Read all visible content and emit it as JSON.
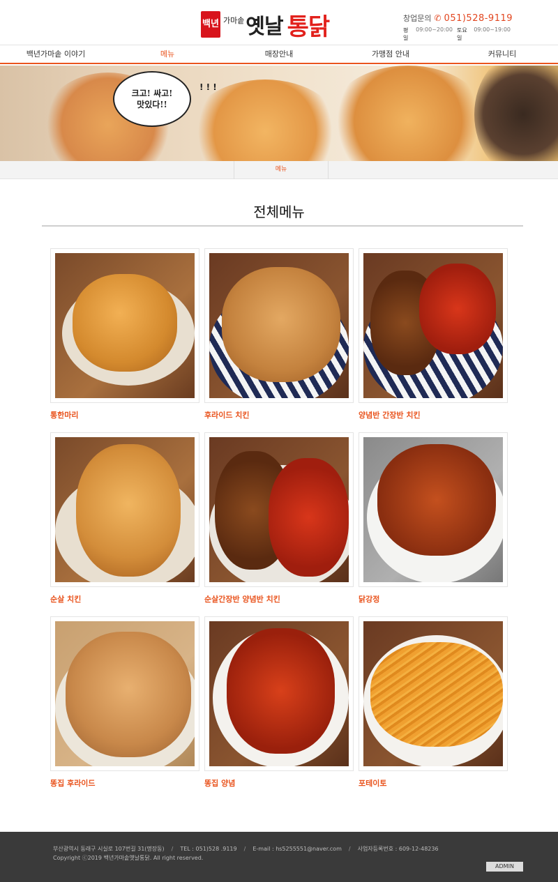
{
  "header": {
    "logo": {
      "badge_text": "백년",
      "small_text": "가마솥",
      "main_text": "옛날",
      "accent_text": "통닭"
    },
    "contact": {
      "label": "창업문의",
      "icon": "phone-icon",
      "phone": "051)528-9119",
      "weekday_label": "평일",
      "weekday_hours": "09:00~20:00",
      "saturday_label": "토요일",
      "saturday_hours": "09:00~19:00"
    }
  },
  "nav": {
    "items": [
      {
        "label": "백년가마솥 이야기",
        "active": false
      },
      {
        "label": "메뉴",
        "active": true
      },
      {
        "label": "매장안내",
        "active": false
      },
      {
        "label": "가맹점 안내",
        "active": false
      },
      {
        "label": "커뮤니티",
        "active": false
      }
    ]
  },
  "banner": {
    "bubble_line1": "크고! 싸고!",
    "bubble_line2": "맛있다!!",
    "marks": "! ! !"
  },
  "breadcrumb": {
    "current": "메뉴"
  },
  "main": {
    "title": "전체메뉴"
  },
  "menu": {
    "items": [
      {
        "label": "통한마리"
      },
      {
        "label": "후라이드 치킨"
      },
      {
        "label": "양념반 간장반 치킨"
      },
      {
        "label": "순살 치킨"
      },
      {
        "label": "순살간장반 양념반 치킨"
      },
      {
        "label": "닭강정"
      },
      {
        "label": "똥집 후라이드"
      },
      {
        "label": "똥집 양념"
      },
      {
        "label": "포테이토"
      }
    ]
  },
  "footer": {
    "address": "부산광역시 동래구 시실로 107번길 31(명장동)",
    "tel": "TEL : 051)528 .9119",
    "email": "E-mail : hs5255551@naver.com",
    "biz_number": "사업자등록번호 : 609-12-48236",
    "copyright": "Copyright ⓒ2019 백년가마솥옛날통닭. All right reserved.",
    "admin_label": "ADMIN"
  },
  "colors": {
    "accent": "#e9541e",
    "brand_red": "#e2211c",
    "footer_bg": "#3a3a3a"
  }
}
